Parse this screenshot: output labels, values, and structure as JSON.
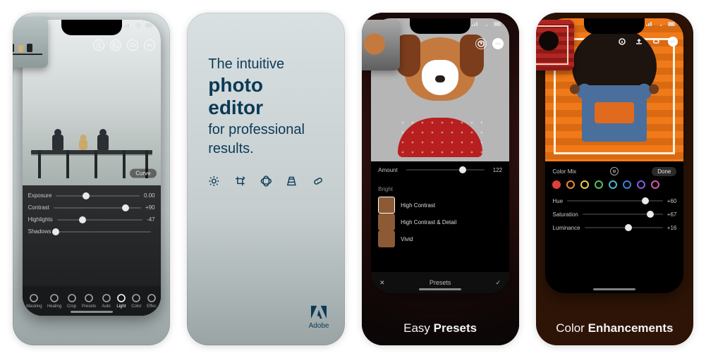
{
  "card1": {
    "thumb_name": "pier-thumbnail",
    "status_icons": [
      "signal-icon",
      "wifi-icon",
      "battery-icon"
    ],
    "top_icons": [
      "person-icon",
      "image-icon",
      "cloud-icon",
      "more-icon"
    ],
    "curve_label": "Curve",
    "sliders": [
      {
        "label": "Exposure",
        "value": "0.00",
        "pos": 0.36
      },
      {
        "label": "Contrast",
        "value": "+90",
        "pos": 0.82
      },
      {
        "label": "Highlights",
        "value": "-47",
        "pos": 0.3
      },
      {
        "label": "Shadows",
        "value": "",
        "pos": 0
      }
    ],
    "tools": [
      {
        "icon": "masking-icon",
        "label": "Masking"
      },
      {
        "icon": "healing-icon",
        "label": "Healing"
      },
      {
        "icon": "crop-icon",
        "label": "Crop"
      },
      {
        "icon": "presets-icon",
        "label": "Presets"
      },
      {
        "icon": "auto-icon",
        "label": "Auto"
      },
      {
        "icon": "light-icon",
        "label": "Light",
        "active": true
      },
      {
        "icon": "color-icon",
        "label": "Color"
      },
      {
        "icon": "effects-icon",
        "label": "Effec"
      }
    ]
  },
  "card2": {
    "line1": "The intuitive",
    "line2": "photo editor",
    "line3a": "for professional",
    "line3b": "results.",
    "icons": [
      "sun-icon",
      "crop-rotate-icon",
      "lens-icon",
      "geometry-icon",
      "healing-brush-icon"
    ],
    "brand": "Adobe"
  },
  "card3": {
    "top_icons": [
      "help-icon",
      "more-icon"
    ],
    "amount_label": "Amount",
    "amount_value": "122",
    "section_label": "Bright",
    "presets": [
      {
        "label": "High Contrast",
        "selected": true
      },
      {
        "label": "High Contrast & Detail",
        "selected": false
      },
      {
        "label": "Vivid",
        "selected": false
      }
    ],
    "sheet_title": "Presets",
    "close_icon": "close-icon",
    "confirm_icon": "check-icon",
    "caption_light": "Easy ",
    "caption_bold": "Presets"
  },
  "card4": {
    "top_icons": [
      "info-icon",
      "share-icon",
      "cloud-icon",
      "more-icon"
    ],
    "panel_title": "Color Mix",
    "done_label": "Done",
    "target_icon": "target-icon",
    "swatch_colors": [
      "#e0403a",
      "#ef8a2c",
      "#e8d24a",
      "#5bbf5b",
      "#4db8c9",
      "#3a7fe0",
      "#8a5ae0",
      "#d65aa6"
    ],
    "selected_swatch": 0,
    "sliders": [
      {
        "label": "Hue",
        "value": "+60",
        "pos": 0.82
      },
      {
        "label": "Saturation",
        "value": "+67",
        "pos": 0.84
      },
      {
        "label": "Luminance",
        "value": "+16",
        "pos": 0.56
      }
    ],
    "caption_light": "Color ",
    "caption_bold": "Enhancements"
  }
}
